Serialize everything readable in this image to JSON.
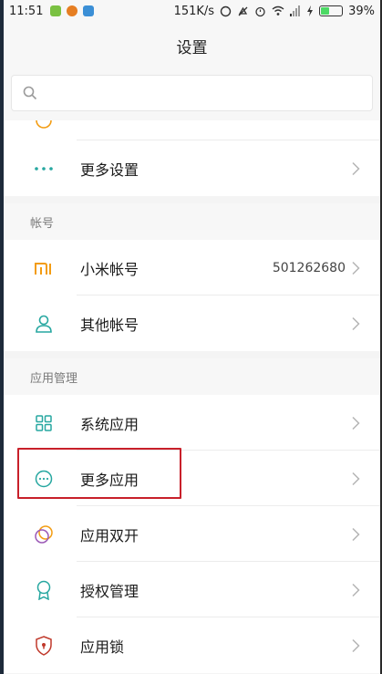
{
  "status_bar": {
    "time": "11:51",
    "net_speed": "151K/s",
    "battery_pct": "39%"
  },
  "header": {
    "title": "设置"
  },
  "search": {
    "placeholder": ""
  },
  "partial_item": {
    "label": ""
  },
  "more_settings": {
    "label": "更多设置"
  },
  "account_section": {
    "title": "帐号",
    "items": [
      {
        "label": "小米帐号",
        "value": "501262680",
        "icon": "mi-logo-icon"
      },
      {
        "label": "其他帐号",
        "icon": "person-icon"
      }
    ]
  },
  "apps_section": {
    "title": "应用管理",
    "items": [
      {
        "label": "系统应用",
        "icon": "grid-icon"
      },
      {
        "label": "更多应用",
        "icon": "more-circle-icon"
      },
      {
        "label": "应用双开",
        "icon": "dual-circles-icon"
      },
      {
        "label": "授权管理",
        "icon": "badge-icon"
      },
      {
        "label": "应用锁",
        "icon": "shield-lock-icon"
      }
    ]
  },
  "colors": {
    "highlight": "#c8202a",
    "mi_orange": "#f39c12",
    "teal": "#26a7a0",
    "purple": "#9b59b6"
  }
}
